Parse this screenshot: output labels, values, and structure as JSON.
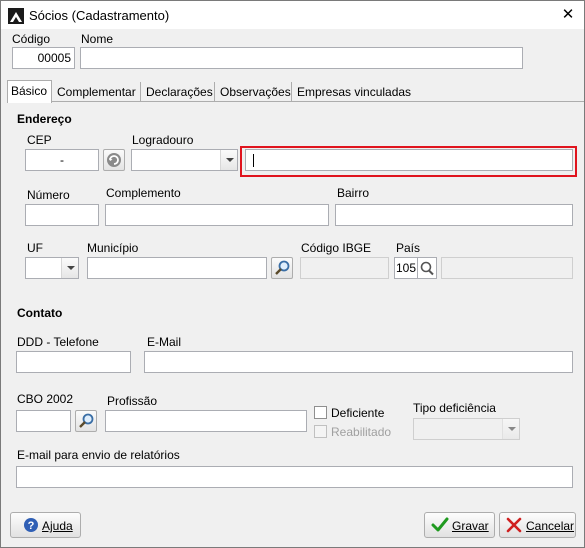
{
  "window": {
    "title": "Sócios (Cadastramento)"
  },
  "header": {
    "codigo_label": "Código",
    "codigo_value": "00005",
    "nome_label": "Nome",
    "nome_value": ""
  },
  "tabs": [
    {
      "label": "Básico",
      "active": true
    },
    {
      "label": "Complementar"
    },
    {
      "label": "Declarações"
    },
    {
      "label": "Observações"
    },
    {
      "label": "Empresas vinculadas"
    }
  ],
  "endereco": {
    "section_label": "Endereço",
    "cep_label": "CEP",
    "cep_value": "-",
    "logradouro_label": "Logradouro",
    "logradouro_type_value": "",
    "logradouro_value": "",
    "numero_label": "Número",
    "complemento_label": "Complemento",
    "bairro_label": "Bairro",
    "uf_label": "UF",
    "municipio_label": "Município",
    "codigo_ibge_label": "Código IBGE",
    "pais_label": "País",
    "pais_value": "105"
  },
  "contato": {
    "section_label": "Contato",
    "ddd_label": "DDD - Telefone",
    "email_label": "E-Mail",
    "cbo_label": "CBO 2002",
    "profissao_label": "Profissão",
    "deficiente_label": "Deficiente",
    "reabilitado_label": "Reabilitado",
    "tipo_deficiencia_label": "Tipo deficiência",
    "email_relatorios_label": "E-mail para envio de relatórios"
  },
  "footer": {
    "help_label": "Ajuda",
    "save_label": "Gravar",
    "cancel_label": "Cancelar"
  },
  "colors": {
    "highlight": "#e0141e",
    "save_check": "#1f9a1f",
    "cancel_x": "#d02020"
  }
}
